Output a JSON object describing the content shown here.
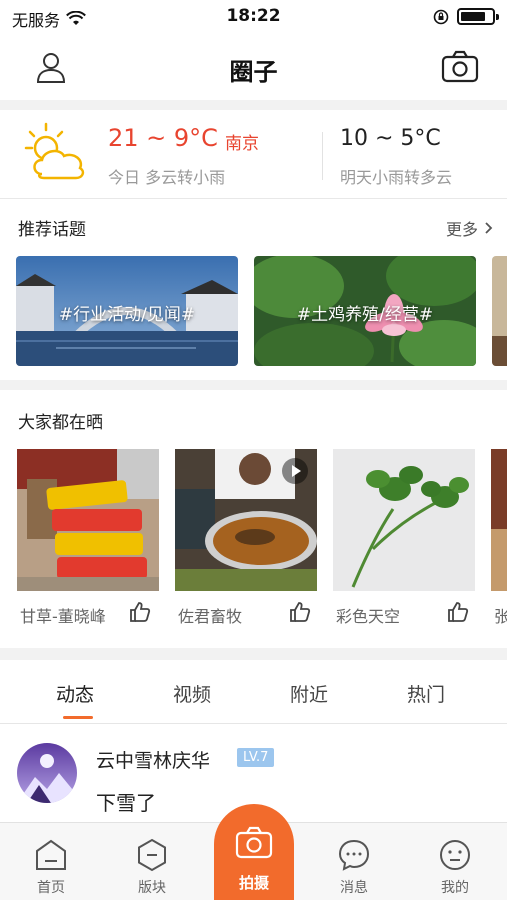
{
  "status_bar": {
    "carrier": "无服务",
    "time": "18:22"
  },
  "header": {
    "title": "圈子"
  },
  "weather": {
    "today_temp": "21 ~ 9°C",
    "city": "南京",
    "today_desc": "今日 多云转小雨",
    "tomorrow_temp": "10 ~ 5°C",
    "tomorrow_desc": "明天小雨转多云"
  },
  "topics": {
    "title": "推荐话题",
    "more": "更多",
    "items": [
      {
        "label": "#行业活动/见闻#"
      },
      {
        "label": "#土鸡养殖/经营#"
      }
    ]
  },
  "showcase": {
    "title": "大家都在晒",
    "items": [
      {
        "user": "甘草-董晓峰"
      },
      {
        "user": "佐君畜牧"
      },
      {
        "user": "彩色天空"
      },
      {
        "user": "张"
      }
    ]
  },
  "feed_tabs": [
    {
      "label": "动态"
    },
    {
      "label": "视频"
    },
    {
      "label": "附近"
    },
    {
      "label": "热门"
    }
  ],
  "post": {
    "user": "云中雪林庆华",
    "level": "LV.7",
    "text": "下雪了"
  },
  "tabbar": {
    "items": [
      {
        "label": "首页"
      },
      {
        "label": "版块"
      },
      {
        "label": "拍摄"
      },
      {
        "label": "消息"
      },
      {
        "label": "我的"
      }
    ]
  },
  "colors": {
    "accent": "#f26b2c",
    "weather_red": "#e8442f",
    "level_badge": "#9cc6ee"
  }
}
